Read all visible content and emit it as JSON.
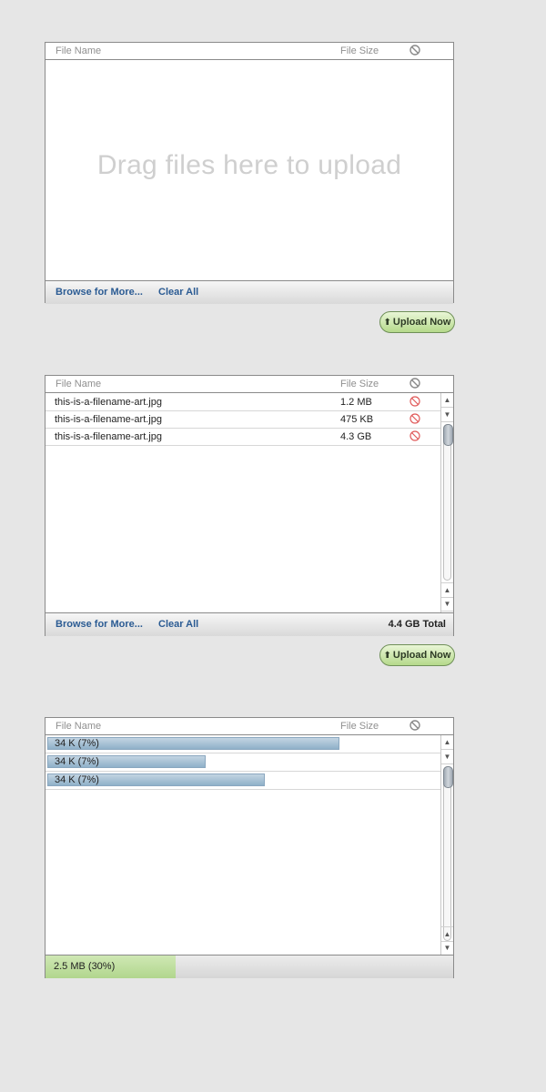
{
  "panel1": {
    "header": {
      "name": "File Name",
      "size": "File Size"
    },
    "dropzone_text": "Drag files here to upload",
    "footer": {
      "browse": "Browse for More...",
      "clear": "Clear All"
    },
    "upload_button": "Upload Now"
  },
  "panel2": {
    "header": {
      "name": "File Name",
      "size": "File Size"
    },
    "rows": [
      {
        "name": "this-is-a-filename-art.jpg",
        "size": "1.2 MB"
      },
      {
        "name": "this-is-a-filename-art.jpg",
        "size": "475 KB"
      },
      {
        "name": "this-is-a-filename-art.jpg",
        "size": "4.3 GB"
      }
    ],
    "footer": {
      "browse": "Browse for More...",
      "clear": "Clear All",
      "total": "4.4 GB Total"
    },
    "upload_button": "Upload Now"
  },
  "panel3": {
    "header": {
      "name": "File Name",
      "size": "File Size"
    },
    "rows": [
      {
        "label": "34 K (7%)",
        "progress": 0.74
      },
      {
        "label": "34 K (7%)",
        "progress": 0.4
      },
      {
        "label": "34 K (7%)",
        "progress": 0.55
      }
    ],
    "total": {
      "label": "2.5 MB (30%)",
      "progress": 0.32
    }
  },
  "colors": {
    "link": "#2b5b93",
    "remove_icon": "#e05a5a",
    "progress_bar": "#9fb9cf",
    "total_progress": "#b9dc95",
    "upload_button": "#c3e09e"
  },
  "icons": {
    "remove_header": "no-symbol-icon",
    "remove_row": "remove-icon",
    "upload": "up-arrow-icon"
  }
}
